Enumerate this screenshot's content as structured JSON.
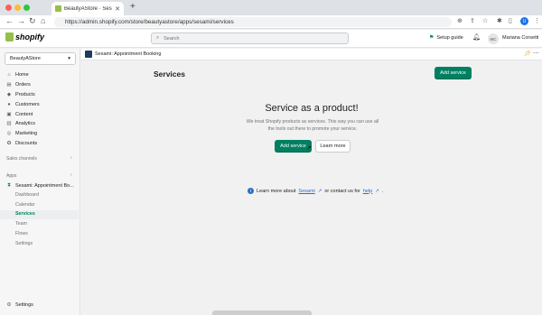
{
  "browser": {
    "tab_title": "BeautyAStore · Sesami: Appoin",
    "tab_close": "✕",
    "new_tab": "+",
    "url": "https://admin.shopify.com/store/beautyastore/apps/sesami/services",
    "profile_initial": "U",
    "colors": {
      "close": "#ff5f57",
      "minimize": "#febc2e",
      "maximize": "#28c840"
    }
  },
  "topbar": {
    "logo_text": "shopify",
    "search_placeholder": "Search",
    "setup_guide": "Setup guide",
    "avatar_initials": "MC",
    "user_name": "Mariana Corsetti"
  },
  "sidebar": {
    "store_name": "BeautyAStore",
    "nav": [
      {
        "label": "Home",
        "icon": "home-icon"
      },
      {
        "label": "Orders",
        "icon": "orders-icon"
      },
      {
        "label": "Products",
        "icon": "products-icon"
      },
      {
        "label": "Customers",
        "icon": "customers-icon"
      },
      {
        "label": "Content",
        "icon": "content-icon"
      },
      {
        "label": "Analytics",
        "icon": "analytics-icon"
      },
      {
        "label": "Marketing",
        "icon": "marketing-icon"
      },
      {
        "label": "Discounts",
        "icon": "discounts-icon"
      }
    ],
    "sales_channels": "Sales channels",
    "apps": "Apps",
    "app_name": "Sesami: Appointment Bo...",
    "app_subitems": [
      "Dashboard",
      "Calendar",
      "Services",
      "Team",
      "Flows",
      "Settings"
    ],
    "settings": "Settings"
  },
  "app_header": {
    "title": "Sesami: Appointment Booking"
  },
  "main": {
    "page_title": "Services",
    "add_service": "Add service",
    "hero_title": "Service as a product!",
    "description": "We treat Shopify products as services. This way you can use all the tools out there to promote your service.",
    "learn_more": "Learn more",
    "footer_prefix": "Learn more about",
    "footer_link1": "Sesami",
    "footer_middle": "or contact us for",
    "footer_link2": "help",
    "footer_suffix": ".",
    "accent_color": "#008060"
  }
}
